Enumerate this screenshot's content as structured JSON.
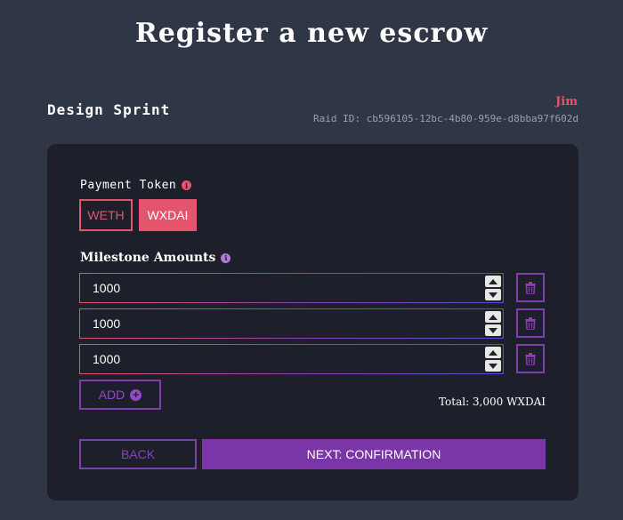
{
  "header": {
    "title": "Register a new escrow",
    "project_name": "Design Sprint",
    "client_name": "Jim",
    "raid_id": "Raid ID: cb596105-12bc-4b80-959e-d8bba97f602d"
  },
  "form": {
    "payment_token_label": "Payment Token",
    "tokens": [
      {
        "label": "WETH",
        "selected": false
      },
      {
        "label": "WXDAI",
        "selected": true
      }
    ],
    "milestone_label": "Milestone Amounts",
    "milestones": [
      {
        "value": "1000"
      },
      {
        "value": "1000"
      },
      {
        "value": "1000"
      }
    ],
    "add_label": "ADD",
    "total": "Total: 3,000 WXDAI",
    "back_label": "BACK",
    "next_label": "NEXT: CONFIRMATION"
  },
  "icons": {
    "info": "info-icon",
    "trash": "trash-icon",
    "plus": "plus-circle-icon"
  },
  "colors": {
    "background": "#2f3646",
    "card": "#1d202a",
    "accent_red": "#e4546c",
    "accent_purple": "#7a35a6"
  }
}
